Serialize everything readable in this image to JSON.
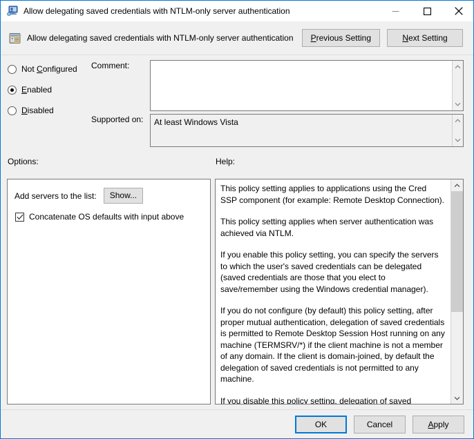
{
  "titlebar": {
    "icon": "computer-policy-icon",
    "title": "Allow delegating saved credentials with NTLM-only server authentication",
    "minimize_label": "minimize-icon",
    "maximize_label": "maximize-icon",
    "close_label": "close-icon"
  },
  "header": {
    "icon": "policy-setting-icon",
    "title": "Allow delegating saved credentials with NTLM-only server authentication",
    "previous_setting": "Previous Setting",
    "previous_accel": "P",
    "next_setting": "Next Setting",
    "next_accel": "N"
  },
  "state": {
    "options": [
      {
        "label": "Not Configured",
        "accel_before": "Not ",
        "accel": "C",
        "accel_after": "onfigured",
        "selected": false
      },
      {
        "label": "Enabled",
        "accel_before": "",
        "accel": "E",
        "accel_after": "nabled",
        "selected": true
      },
      {
        "label": "Disabled",
        "accel_before": "",
        "accel": "D",
        "accel_after": "isabled",
        "selected": false
      }
    ]
  },
  "comment": {
    "label": "Comment:",
    "value": "",
    "scroll_up": "scroll-up-icon",
    "scroll_down": "scroll-down-icon"
  },
  "supported": {
    "label": "Supported on:",
    "value": "At least Windows Vista",
    "scroll_up": "scroll-up-icon",
    "scroll_down": "scroll-down-icon"
  },
  "sections": {
    "options_label": "Options:",
    "help_label": "Help:"
  },
  "options_panel": {
    "add_servers_label": "Add servers to the list:",
    "show_button": "Show...",
    "checkbox_label": "Concatenate OS defaults with input above",
    "checkbox_checked": true
  },
  "help": {
    "paragraphs": [
      "This policy setting applies to applications using the Cred SSP component (for example: Remote Desktop Connection).",
      "This policy setting applies when server authentication was achieved via NTLM.",
      "If you enable this policy setting, you can specify the servers to which the user's saved credentials can be delegated (saved credentials are those that you elect to save/remember using the Windows credential manager).",
      "If you do not configure (by default) this policy setting, after proper mutual authentication, delegation of saved credentials is permitted to Remote Desktop Session Host running on any machine (TERMSRV/*) if the client machine is not a member of any domain. If the client is domain-joined, by default the delegation of saved credentials is not permitted to any machine.",
      "If you disable this policy setting, delegation of saved credentials is not permitted to any machine."
    ],
    "scroll_up": "scroll-up-icon",
    "scroll_down": "scroll-down-icon"
  },
  "footer": {
    "ok": "OK",
    "cancel": "Cancel",
    "apply_before": "",
    "apply_accel": "A",
    "apply_after": "pply"
  },
  "colors": {
    "accent": "#0078d7",
    "dialog_bg": "#f0f0f0",
    "panel_bg": "#ffffff",
    "button_bg": "#e1e1e1",
    "border": "#7a7a7a"
  }
}
